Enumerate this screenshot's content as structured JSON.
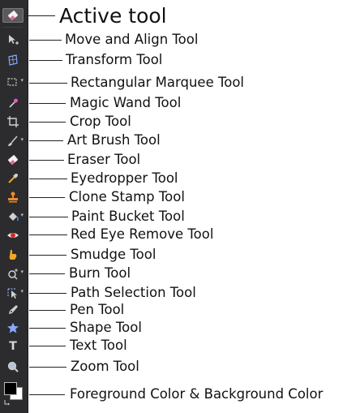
{
  "colors": {
    "toolbar_bg": "#2c2c2e",
    "icon": "#c8c8c8",
    "active_bg": "#5a5a5c",
    "foreground_color": "#000000",
    "background_color": "#ffffff"
  },
  "tools": [
    {
      "id": "active",
      "icon": "eraser-icon",
      "label": "Active tool",
      "active": true
    },
    {
      "id": "move",
      "icon": "move-align-icon",
      "label": "Move and Align Tool"
    },
    {
      "id": "transform",
      "icon": "transform-icon",
      "label": "Transform Tool"
    },
    {
      "id": "marquee",
      "icon": "rectangular-marquee-icon",
      "label": "Rectangular Marquee Tool",
      "has_submenu": true
    },
    {
      "id": "wand",
      "icon": "magic-wand-icon",
      "label": "Magic Wand Tool"
    },
    {
      "id": "crop",
      "icon": "crop-icon",
      "label": "Crop Tool"
    },
    {
      "id": "brush",
      "icon": "art-brush-icon",
      "label": "Art Brush Tool",
      "has_submenu": true
    },
    {
      "id": "eraser",
      "icon": "eraser-icon",
      "label": "Eraser Tool"
    },
    {
      "id": "eyedropper",
      "icon": "eyedropper-icon",
      "label": "Eyedropper Tool"
    },
    {
      "id": "clone",
      "icon": "clone-stamp-icon",
      "label": "Clone Stamp Tool"
    },
    {
      "id": "bucket",
      "icon": "paint-bucket-icon",
      "label": "Paint Bucket Tool",
      "has_submenu": true
    },
    {
      "id": "redeye",
      "icon": "red-eye-icon",
      "label": "Red Eye Remove Tool"
    },
    {
      "id": "smudge",
      "icon": "smudge-icon",
      "label": "Smudge Tool"
    },
    {
      "id": "burn",
      "icon": "burn-icon",
      "label": "Burn Tool",
      "has_submenu": true
    },
    {
      "id": "path",
      "icon": "path-selection-icon",
      "label": "Path Selection Tool",
      "has_submenu": true
    },
    {
      "id": "pen",
      "icon": "pen-icon",
      "label": "Pen Tool"
    },
    {
      "id": "shape",
      "icon": "shape-star-icon",
      "label": "Shape Tool"
    },
    {
      "id": "text",
      "icon": "text-icon",
      "label": "Text Tool"
    },
    {
      "id": "zoom",
      "icon": "zoom-icon",
      "label": "Zoom Tool"
    }
  ],
  "swatch": {
    "icon": "color-swatch-icon",
    "label": "Foreground Color & Background Color"
  },
  "submenu_glyph": "▾",
  "text_tool_glyph": "T"
}
